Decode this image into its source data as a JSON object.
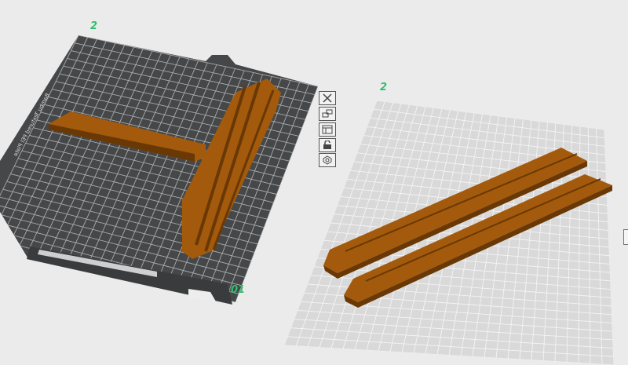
{
  "viewport": {
    "background": "#ebebeb",
    "plates": [
      {
        "index_label": "01",
        "top_label": "2",
        "bed_text": "Bambu Textured PEI Plate",
        "surface": "#454748",
        "grid": "#a9abad",
        "active": true
      },
      {
        "top_label": "2",
        "surface": "#d9d9d9",
        "grid": "#f4f4f4",
        "active": false
      }
    ],
    "model_color": "#a35a0c",
    "model_shadow": "#6a3804"
  },
  "plate_toolbar": [
    {
      "icon": "close-icon",
      "name": "remove-plate-button"
    },
    {
      "icon": "arrange-icon",
      "name": "arrange-plate-button"
    },
    {
      "icon": "plate-settings-icon",
      "name": "plate-layout-button"
    },
    {
      "icon": "lock-icon",
      "name": "lock-plate-button"
    },
    {
      "icon": "gear-icon",
      "name": "plate-settings-button"
    }
  ]
}
